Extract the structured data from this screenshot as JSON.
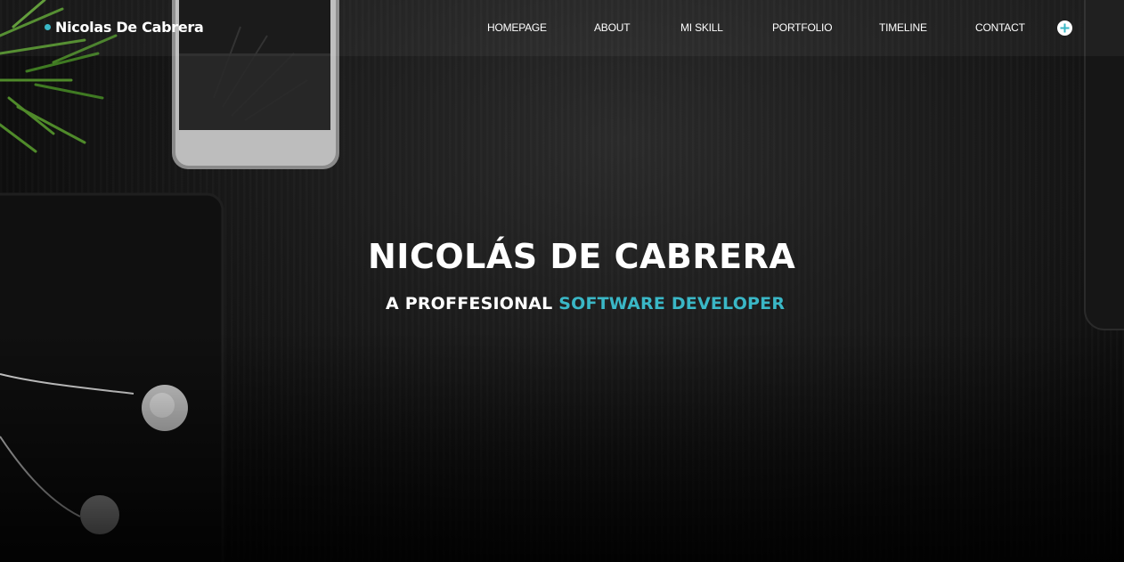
{
  "brand": {
    "name": "Nicolas De Cabrera",
    "dot_color": "#3ab7c6"
  },
  "nav": {
    "items": [
      {
        "label": "HOMEPAGE"
      },
      {
        "label": "ABOUT"
      },
      {
        "label": "MI SKILL"
      },
      {
        "label": "PORTFOLIO"
      },
      {
        "label": "TIMELINE"
      },
      {
        "label": "CONTACT"
      }
    ],
    "extra_icon": "plus-circle-icon"
  },
  "hero": {
    "title": "NICOLÁS DE CABRERA",
    "subtitle_prefix": "A PROFFESIONAL",
    "subtitle_highlight": "SOFTWARE DEVELOPER",
    "accent_color": "#3ab7c6"
  }
}
